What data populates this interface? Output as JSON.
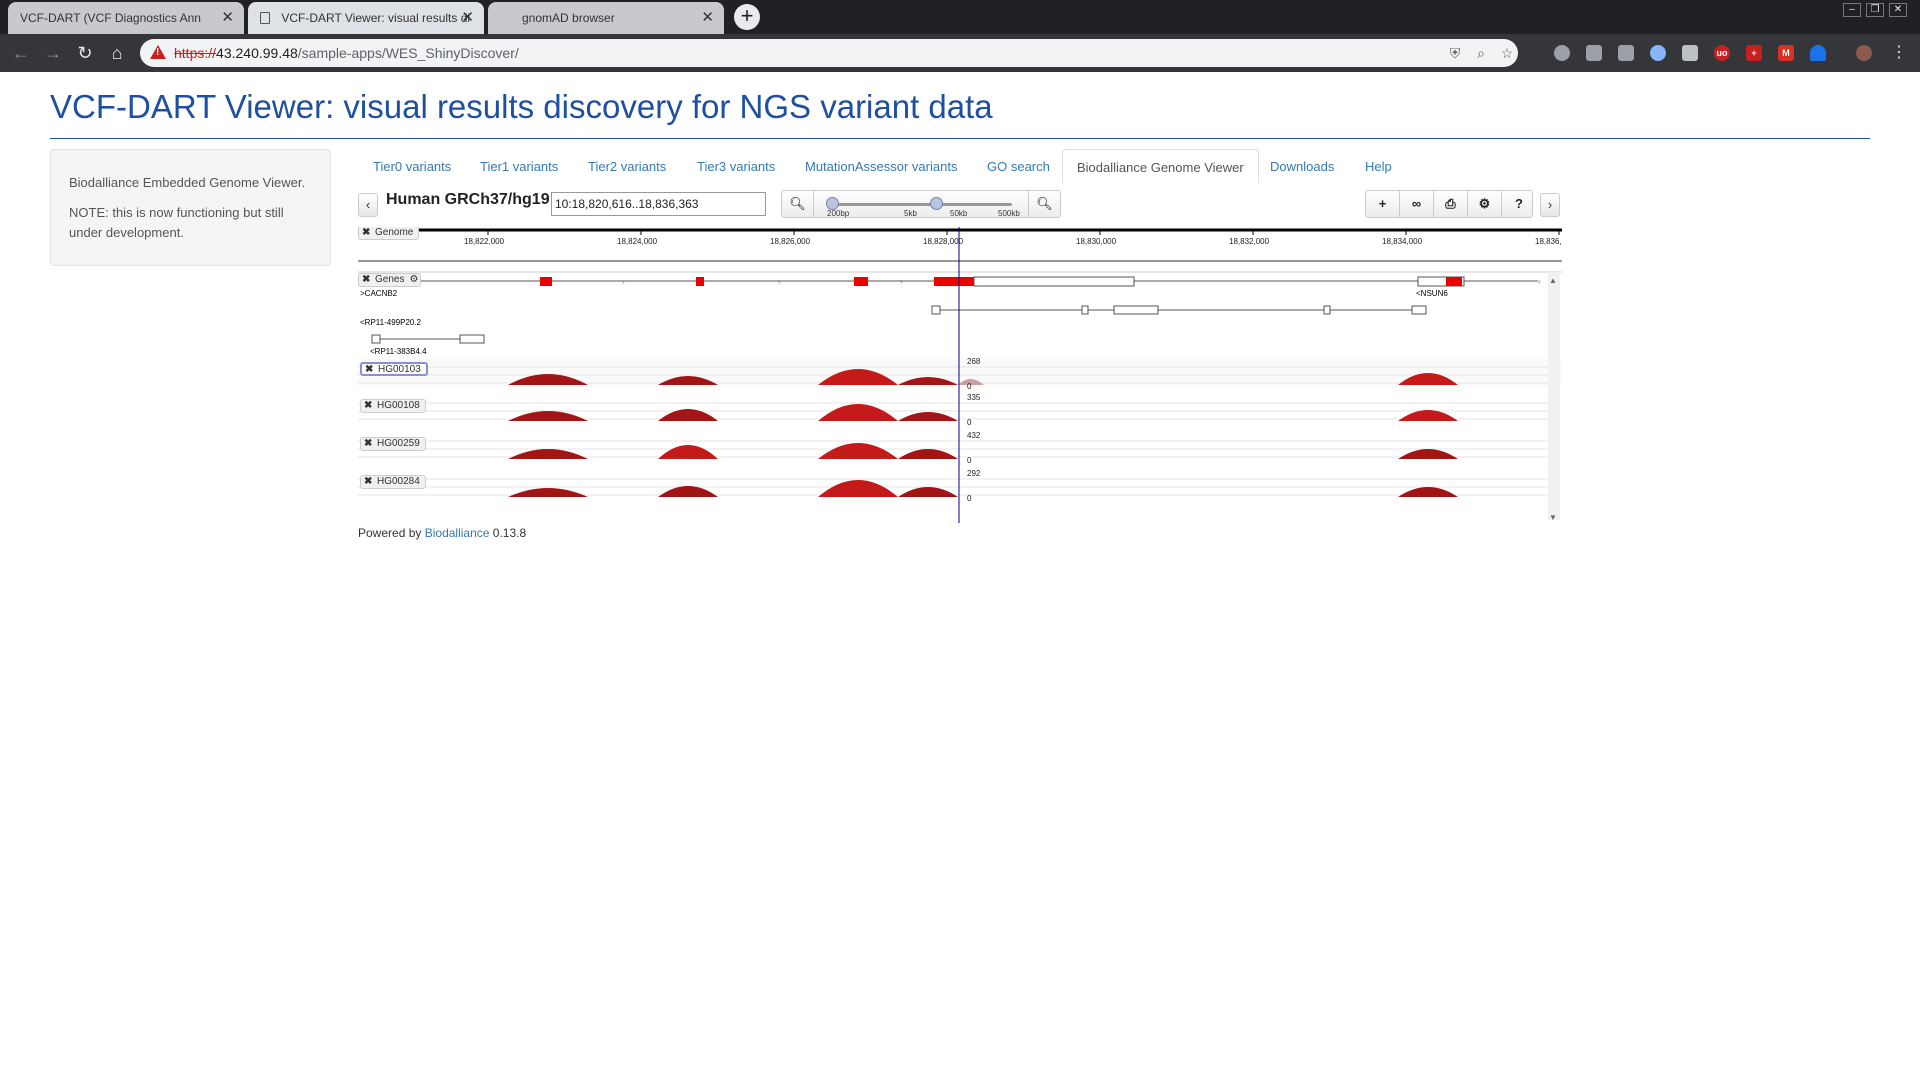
{
  "browser": {
    "tabs": [
      {
        "title": "VCF-DART (VCF Diagnostics Ann"
      },
      {
        "title": "VCF-DART Viewer: visual results di"
      },
      {
        "title": "gnomAD browser"
      }
    ],
    "url_scheme": "https://",
    "url_host": "43.240.99.48",
    "url_path": "/sample-apps/WES_ShinyDiscover/"
  },
  "page": {
    "title": "VCF-DART Viewer: visual results discovery for NGS variant data"
  },
  "sidebar": {
    "line1": "Biodalliance Embedded Genome Viewer.",
    "line2": "NOTE: this is now functioning but still under development."
  },
  "nav": {
    "tabs": [
      "Tier0 variants",
      "Tier1 variants",
      "Tier2 variants",
      "Tier3 variants",
      "MutationAssessor variants",
      "GO search",
      "Biodalliance Genome Viewer",
      "Downloads",
      "Help"
    ],
    "active": "Biodalliance Genome Viewer"
  },
  "viewer": {
    "genome_name": "Human GRCh37/hg19",
    "location": "10:18,820,616..18,836,363",
    "zoom_labels": [
      "200bp",
      "5kb",
      "50kb",
      "500kb"
    ],
    "ruler_ticks": [
      "18,822,000",
      "18,824,000",
      "18,826,000",
      "18,828,000",
      "18,830,000",
      "18,832,000",
      "18,834,000",
      "18,836,"
    ],
    "tracks": {
      "genome": "Genome",
      "genes": "Genes",
      "gene_labels": [
        ">CACNB2",
        "<NSUN6",
        "<RP11-499P20.2",
        "<RP11-383B4.4"
      ],
      "samples": [
        {
          "name": "HG00103",
          "max": "268",
          "min": "0"
        },
        {
          "name": "HG00108",
          "max": "335",
          "min": "0"
        },
        {
          "name": "HG00259",
          "max": "432",
          "min": "0"
        },
        {
          "name": "HG00284",
          "max": "292",
          "min": "0"
        }
      ]
    },
    "icons": {
      "zoom_out": "zoom-out-icon",
      "zoom_in": "zoom-in-icon",
      "add_track": "plus-icon",
      "binoculars": "binoculars-icon",
      "print": "print-icon",
      "settings": "gears-icon",
      "help": "help-icon"
    }
  },
  "footer": {
    "powered_prefix": "Powered by",
    "powered_link": "Biodalliance",
    "version": "0.13.8"
  },
  "colors": {
    "title": "#1f4fa0",
    "link": "#337ab7",
    "exon": "#ee0000",
    "coverage": "#b01010",
    "cursor": "#00008b"
  }
}
